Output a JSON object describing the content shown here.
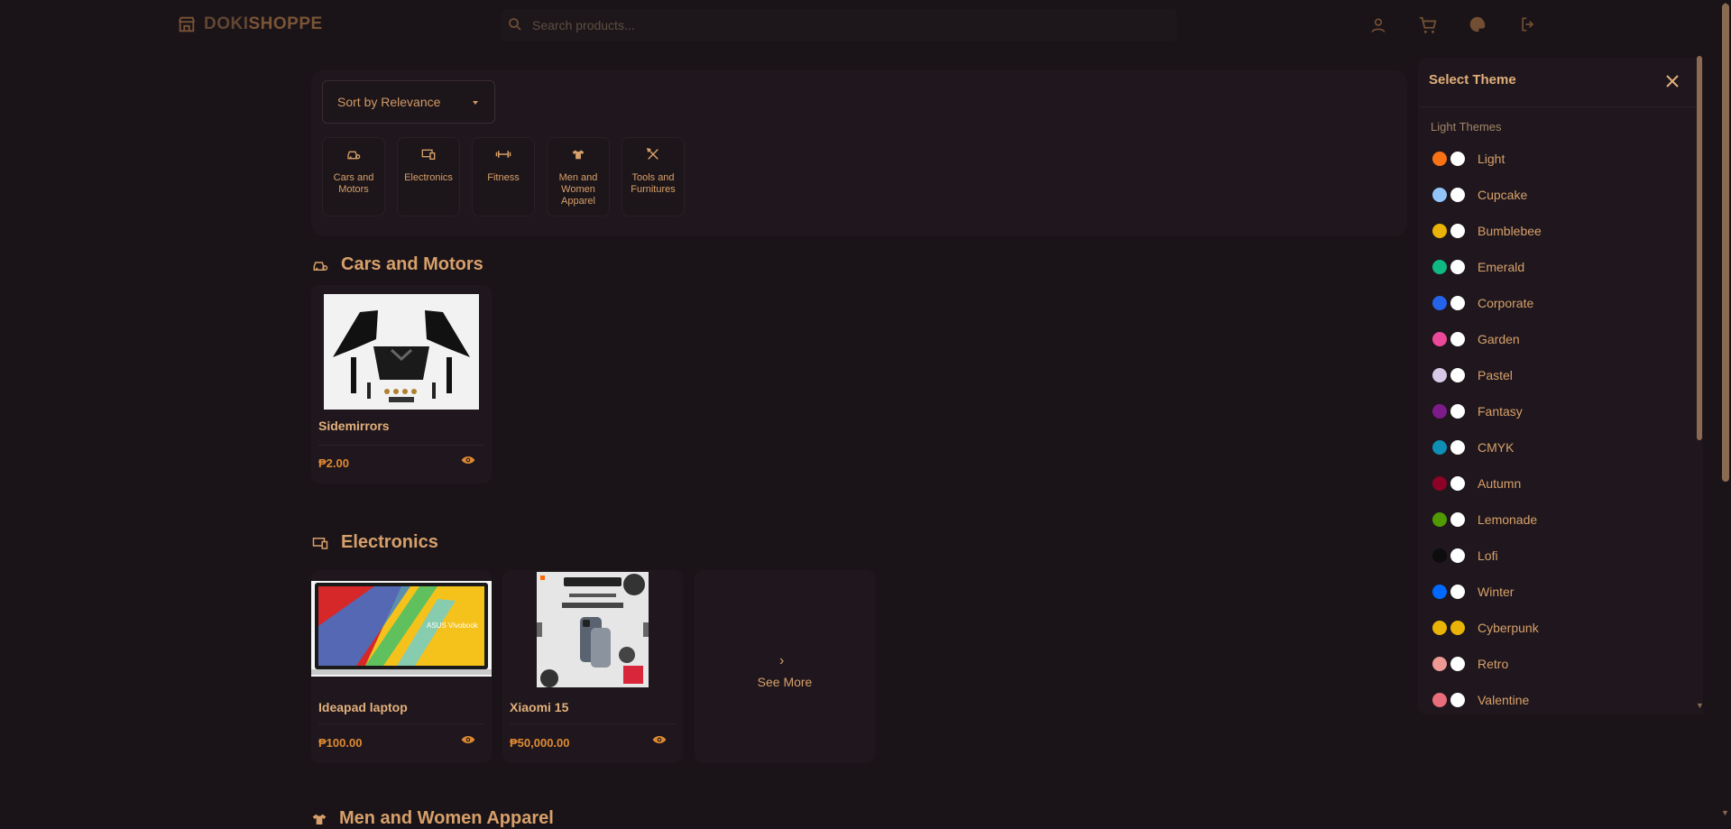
{
  "header": {
    "logo_prefix": "DOKI",
    "logo_suffix": "SHOPPE",
    "search_placeholder": "Search products..."
  },
  "filters": {
    "sort_label": "Sort by Relevance",
    "categories": [
      {
        "label": "Cars and Motors",
        "icon": "car-icon"
      },
      {
        "label": "Electronics",
        "icon": "devices-icon"
      },
      {
        "label": "Fitness",
        "icon": "dumbbell-icon"
      },
      {
        "label": "Men and Women Apparel",
        "icon": "shirt-icon"
      },
      {
        "label": "Tools and Furnitures",
        "icon": "tools-icon"
      }
    ]
  },
  "sections": {
    "cars": {
      "title": "Cars and Motors",
      "products": [
        {
          "name": "Sidemirrors",
          "price": "₱2.00"
        }
      ]
    },
    "electronics": {
      "title": "Electronics",
      "products": [
        {
          "name": "Ideapad laptop",
          "price": "₱100.00"
        },
        {
          "name": "Xiaomi 15",
          "price": "₱50,000.00"
        }
      ],
      "see_more": "See More"
    },
    "apparel": {
      "title": "Men and Women Apparel"
    }
  },
  "theme_panel": {
    "title": "Select Theme",
    "subtitle": "Light Themes",
    "themes": [
      {
        "name": "Light",
        "colors": [
          "#f97316",
          "#ffffff"
        ]
      },
      {
        "name": "Cupcake",
        "colors": [
          "#93c5fd",
          "#ffffff"
        ]
      },
      {
        "name": "Bumblebee",
        "colors": [
          "#eab308",
          "#ffffff"
        ]
      },
      {
        "name": "Emerald",
        "colors": [
          "#10b981",
          "#ffffff"
        ]
      },
      {
        "name": "Corporate",
        "colors": [
          "#2563eb",
          "#ffffff"
        ]
      },
      {
        "name": "Garden",
        "colors": [
          "#ec4899",
          "#ffffff"
        ]
      },
      {
        "name": "Pastel",
        "colors": [
          "#d8c8e8",
          "#ffffff"
        ]
      },
      {
        "name": "Fantasy",
        "colors": [
          "#7e1b8a",
          "#ffffff"
        ]
      },
      {
        "name": "CMYK",
        "colors": [
          "#0e8fb5",
          "#ffffff"
        ]
      },
      {
        "name": "Autumn",
        "colors": [
          "#8c0327",
          "#ffffff"
        ]
      },
      {
        "name": "Lemonade",
        "colors": [
          "#519903",
          "#ffffff"
        ]
      },
      {
        "name": "Lofi",
        "colors": [
          "#0d0d0d",
          "#ffffff"
        ]
      },
      {
        "name": "Winter",
        "colors": [
          "#0069ff",
          "#ffffff"
        ]
      },
      {
        "name": "Cyberpunk",
        "colors": [
          "#eab308",
          "#eab308"
        ]
      },
      {
        "name": "Retro",
        "colors": [
          "#ef9995",
          "#ffffff"
        ]
      },
      {
        "name": "Valentine",
        "colors": [
          "#e96d7b",
          "#ffffff"
        ]
      }
    ]
  },
  "colors": {
    "accent": "#d7a06a",
    "price": "#e08a32",
    "background": "#1a1418",
    "panel": "#1f171d"
  }
}
